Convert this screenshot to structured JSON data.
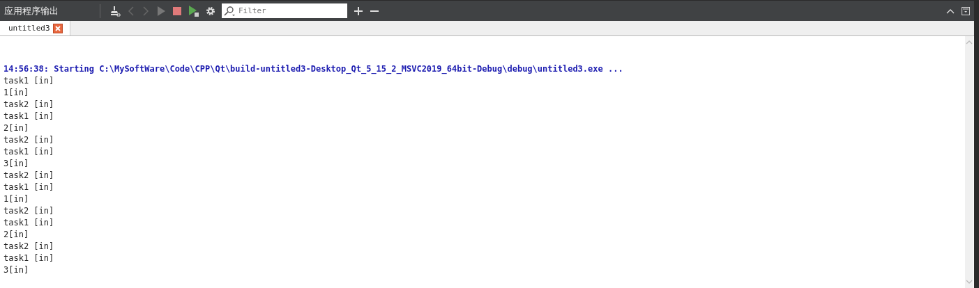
{
  "panel": {
    "title": "应用程序输出"
  },
  "filter": {
    "placeholder": "Filter"
  },
  "tabs": [
    {
      "label": "untitled3",
      "selected": true
    }
  ],
  "output": [
    {
      "kind": "start",
      "text": "14:56:38: Starting C:\\MySoftWare\\Code\\CPP\\Qt\\build-untitled3-Desktop_Qt_5_15_2_MSVC2019_64bit-Debug\\debug\\untitled3.exe ..."
    },
    {
      "kind": "stdout",
      "text": "task1 [in]"
    },
    {
      "kind": "stdout",
      "text": "1[in]"
    },
    {
      "kind": "stdout",
      "text": "task2 [in]"
    },
    {
      "kind": "stdout",
      "text": "task1 [in]"
    },
    {
      "kind": "stdout",
      "text": "2[in]"
    },
    {
      "kind": "stdout",
      "text": "task2 [in]"
    },
    {
      "kind": "stdout",
      "text": "task1 [in]"
    },
    {
      "kind": "stdout",
      "text": "3[in]"
    },
    {
      "kind": "stdout",
      "text": "task2 [in]"
    },
    {
      "kind": "stdout",
      "text": "task1 [in]"
    },
    {
      "kind": "stdout",
      "text": "1[in]"
    },
    {
      "kind": "stdout",
      "text": "task2 [in]"
    },
    {
      "kind": "stdout",
      "text": "task1 [in]"
    },
    {
      "kind": "stdout",
      "text": "2[in]"
    },
    {
      "kind": "stdout",
      "text": "task2 [in]"
    },
    {
      "kind": "stdout",
      "text": "task1 [in]"
    },
    {
      "kind": "stdout",
      "text": "3[in]"
    }
  ]
}
